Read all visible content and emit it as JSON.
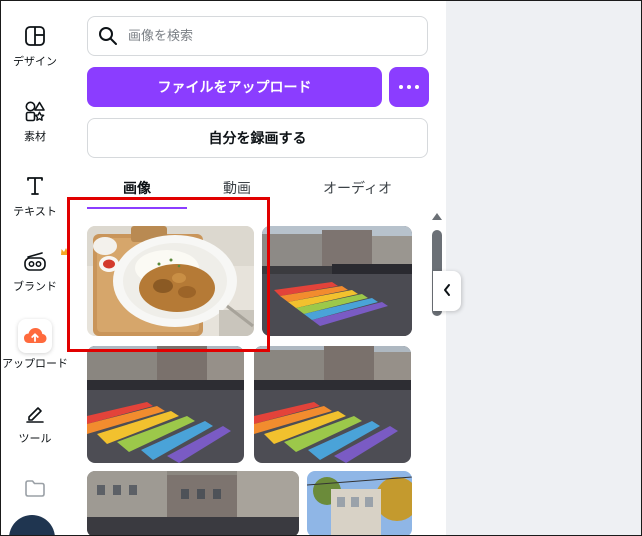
{
  "sidebar": {
    "items": [
      {
        "label": "デザイン",
        "icon": "layout-icon"
      },
      {
        "label": "素材",
        "icon": "shapes-icon"
      },
      {
        "label": "テキスト",
        "icon": "text-icon"
      },
      {
        "label": "ブランド",
        "icon": "brand-icon"
      },
      {
        "label": "アップロード",
        "icon": "cloud-upload-icon"
      },
      {
        "label": "ツール",
        "icon": "pen-icon"
      },
      {
        "label": "",
        "icon": "folder-icon"
      }
    ],
    "active_index": 4
  },
  "search": {
    "placeholder": "画像を検索"
  },
  "actions": {
    "upload_label": "ファイルをアップロード",
    "record_label": "自分を録画する"
  },
  "tabs": [
    {
      "label": "画像",
      "active": true
    },
    {
      "label": "動画",
      "active": false
    },
    {
      "label": "オーディオ",
      "active": false
    }
  ],
  "colors": {
    "accent": "#8b3dff",
    "highlight": "#e10000",
    "canvas_bg": "#eef0f3"
  },
  "thumbnails": [
    {
      "subject": "curry-plate"
    },
    {
      "subject": "rainbow-crosswalk"
    },
    {
      "subject": "rainbow-crosswalk"
    },
    {
      "subject": "rainbow-crosswalk"
    },
    {
      "subject": "street-buildings"
    },
    {
      "subject": "street-trees"
    }
  ]
}
